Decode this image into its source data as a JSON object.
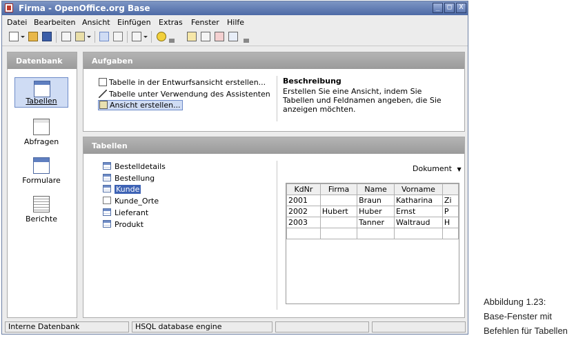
{
  "window": {
    "title": "Firma - OpenOffice.org Base",
    "buttons": [
      "_",
      "□",
      "X"
    ]
  },
  "menu": [
    "Datei",
    "Bearbeiten",
    "Ansicht",
    "Einfügen",
    "Extras",
    "Fenster",
    "Hilfe"
  ],
  "database_panel": {
    "header": "Datenbank",
    "items": [
      {
        "label": "Tabellen",
        "icon": "tables-icon",
        "selected": true
      },
      {
        "label": "Abfragen",
        "icon": "queries-icon",
        "selected": false
      },
      {
        "label": "Formulare",
        "icon": "forms-icon",
        "selected": false
      },
      {
        "label": "Berichte",
        "icon": "reports-icon",
        "selected": false
      }
    ]
  },
  "tasks_panel": {
    "header": "Aufgaben",
    "items": [
      {
        "label": "Tabelle in der Entwurfsansicht erstellen...",
        "icon": "design-view-icon",
        "selected": false
      },
      {
        "label": "Tabelle unter Verwendung des Assistenten",
        "icon": "wizard-icon",
        "selected": false
      },
      {
        "label": "Ansicht erstellen...",
        "icon": "view-icon",
        "selected": true
      }
    ],
    "description_title": "Beschreibung",
    "description_text": "Erstellen Sie eine Ansicht, indem Sie Tabellen und Feldnamen angeben, die Sie anzeigen möchten."
  },
  "tables_panel": {
    "header": "Tabellen",
    "items": [
      {
        "label": "Bestelldetails",
        "icon": "table-icon",
        "selected": false
      },
      {
        "label": "Bestellung",
        "icon": "table-icon",
        "selected": false
      },
      {
        "label": "Kunde",
        "icon": "table-icon",
        "selected": true
      },
      {
        "label": "Kunde_Orte",
        "icon": "view-icon",
        "selected": false
      },
      {
        "label": "Lieferant",
        "icon": "table-icon",
        "selected": false
      },
      {
        "label": "Produkt",
        "icon": "table-icon",
        "selected": false
      }
    ],
    "preview_mode": "Dokument",
    "preview": {
      "columns": [
        "KdNr",
        "Firma",
        "Name",
        "Vorname",
        ""
      ],
      "rows": [
        [
          "2001",
          "",
          "Braun",
          "Katharina",
          "Zi"
        ],
        [
          "2002",
          "Hubert",
          "Huber",
          "Ernst",
          "P"
        ],
        [
          "2003",
          "",
          "Tanner",
          "Waltraud",
          "H"
        ],
        [
          "",
          "",
          "",
          "",
          ""
        ]
      ]
    }
  },
  "statusbar": [
    "Interne Datenbank",
    "HSQL database engine",
    "",
    ""
  ],
  "caption": [
    "Abbildung 1.23:",
    "Base-Fenster mit",
    "Befehlen für Tabellen"
  ],
  "colors": {
    "titlebar": "#4d6aa6",
    "selection": "#3e63b5",
    "panel_header": "#a6a6a6"
  }
}
